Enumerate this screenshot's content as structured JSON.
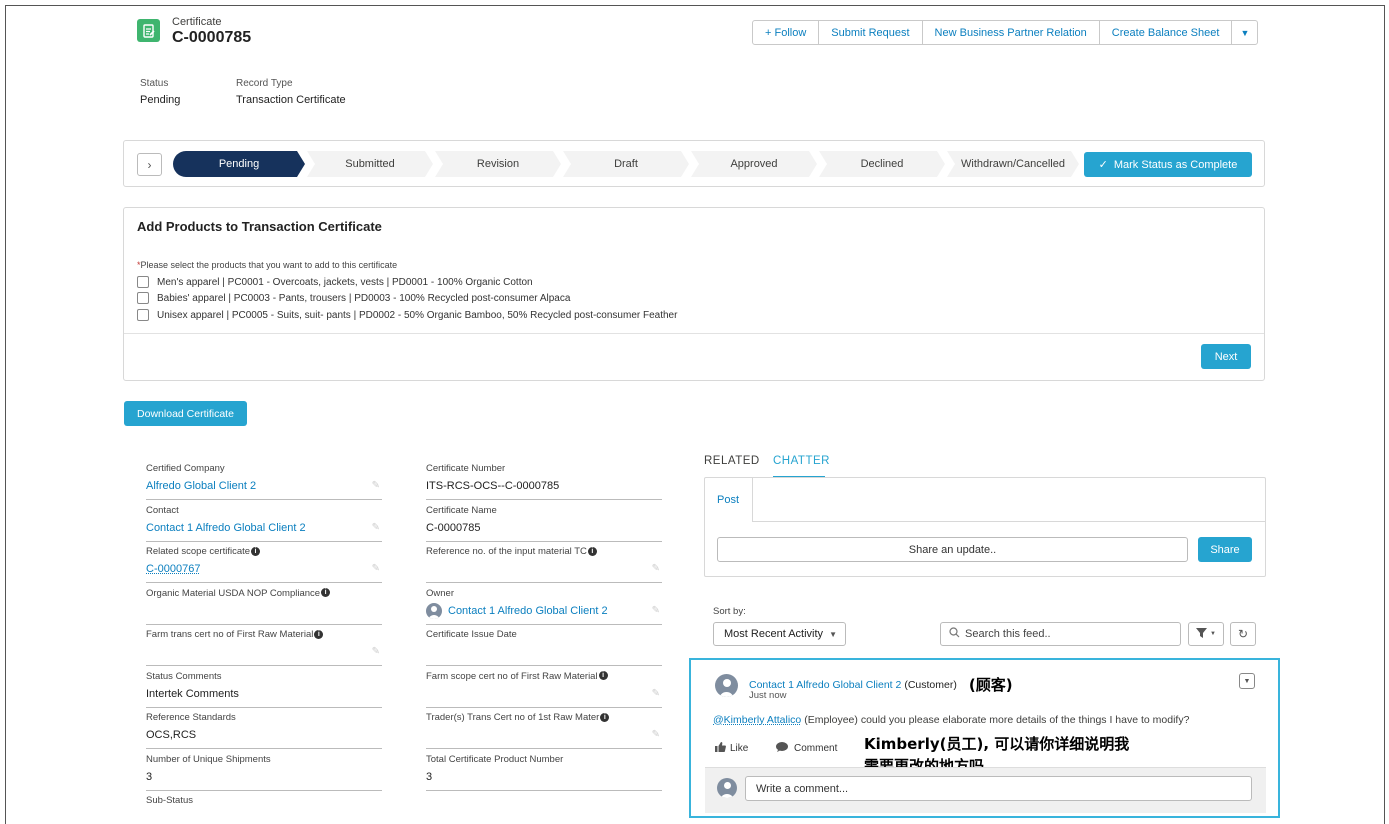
{
  "header": {
    "object_type": "Certificate",
    "record_name": "C-0000785",
    "actions": [
      "+ Follow",
      "Submit Request",
      "New Business Partner Relation",
      "Create Balance Sheet"
    ],
    "more_icon": "chevron-down-icon"
  },
  "highlights": {
    "status_label": "Status",
    "status_value": "Pending",
    "record_type_label": "Record Type",
    "record_type_value": "Transaction Certificate"
  },
  "path": {
    "stages": [
      "Pending",
      "Submitted",
      "Revision",
      "Draft",
      "Approved",
      "Declined",
      "Withdrawn/Cancelled"
    ],
    "active": "Pending",
    "mark_complete": "Mark Status as Complete"
  },
  "products_card": {
    "title": "Add Products to Transaction Certificate",
    "required_marker": "*",
    "hint": "Please select the products that you want to add to this certificate",
    "products": [
      "Men's apparel | PC0001 - Overcoats, jackets, vests | PD0001 - 100% Organic Cotton",
      "Babies' apparel | PC0003 - Pants, trousers | PD0003 - 100% Recycled post-consumer Alpaca",
      "Unisex apparel | PC0005 - Suits, suit- pants | PD0002 - 50% Organic Bamboo, 50% Recycled post-consumer Feather"
    ],
    "next": "Next"
  },
  "download_button": "Download Certificate",
  "fields_left": [
    {
      "label": "Certified Company",
      "value": "Alfredo Global Client 2",
      "link": true,
      "info": false
    },
    {
      "label": "Contact",
      "value": "Contact 1 Alfredo Global Client 2",
      "link": true,
      "info": false
    },
    {
      "label": "Related scope certificate",
      "value": "C-0000767",
      "link": true,
      "info": true
    },
    {
      "label": "Organic Material USDA NOP Compliance",
      "value": "",
      "link": false,
      "info": true
    },
    {
      "label": "Farm trans cert no of First Raw Material",
      "value": "",
      "link": false,
      "info": true
    },
    {
      "label": "Status Comments",
      "value": "Intertek Comments",
      "link": false,
      "info": false
    },
    {
      "label": "Reference Standards",
      "value": "OCS,RCS",
      "link": false,
      "info": false
    },
    {
      "label": "Number of Unique Shipments",
      "value": "3",
      "link": false,
      "info": false
    },
    {
      "label": "Sub-Status",
      "value": "",
      "link": false,
      "info": false
    }
  ],
  "fields_right": [
    {
      "label": "Certificate Number",
      "value": "ITS-RCS-OCS--C-0000785",
      "link": false,
      "info": false
    },
    {
      "label": "Certificate Name",
      "value": "C-0000785",
      "link": false,
      "info": false
    },
    {
      "label": "Reference no. of the input material TC",
      "value": "",
      "link": false,
      "info": true
    },
    {
      "label": "Owner",
      "value": "Contact 1 Alfredo Global Client 2",
      "link": true,
      "info": false,
      "avatar": true
    },
    {
      "label": "Certificate Issue Date",
      "value": "",
      "link": false,
      "info": false
    },
    {
      "label": "Farm scope cert no of First Raw Material",
      "value": "",
      "link": false,
      "info": true
    },
    {
      "label": "Trader(s) Trans Cert no of 1st Raw Mater",
      "value": "",
      "link": false,
      "info": true
    },
    {
      "label": "Total Certificate Product Number",
      "value": "3",
      "link": false,
      "info": false
    }
  ],
  "tabs": {
    "related": "RELATED",
    "chatter": "CHATTER",
    "active": "CHATTER"
  },
  "publisher": {
    "post_tab": "Post",
    "placeholder": "Share an update..",
    "share": "Share"
  },
  "feed": {
    "sort_label": "Sort by:",
    "sort_value": "Most Recent Activity",
    "search_placeholder": "Search this feed..",
    "post": {
      "author": "Contact 1 Alfredo Global Client 2",
      "author_role": "(Customer)",
      "author_role_cn": "(顾客)",
      "time": "Just now",
      "mention": "@Kimberly Attalico",
      "mention_role": "(Employee)",
      "body": "could you please elaborate more details of the things I have to modify?",
      "like": "Like",
      "comment": "Comment",
      "translation_line1": "Kimberly(员工), 可以请你详细说明我",
      "translation_line2": "需要更改的地方吗",
      "comment_placeholder": "Write a comment..."
    }
  },
  "colors": {
    "accent": "#26a4d0",
    "path_active": "#16325c",
    "link": "#0b7fbf",
    "icon_green": "#3fb56f"
  }
}
